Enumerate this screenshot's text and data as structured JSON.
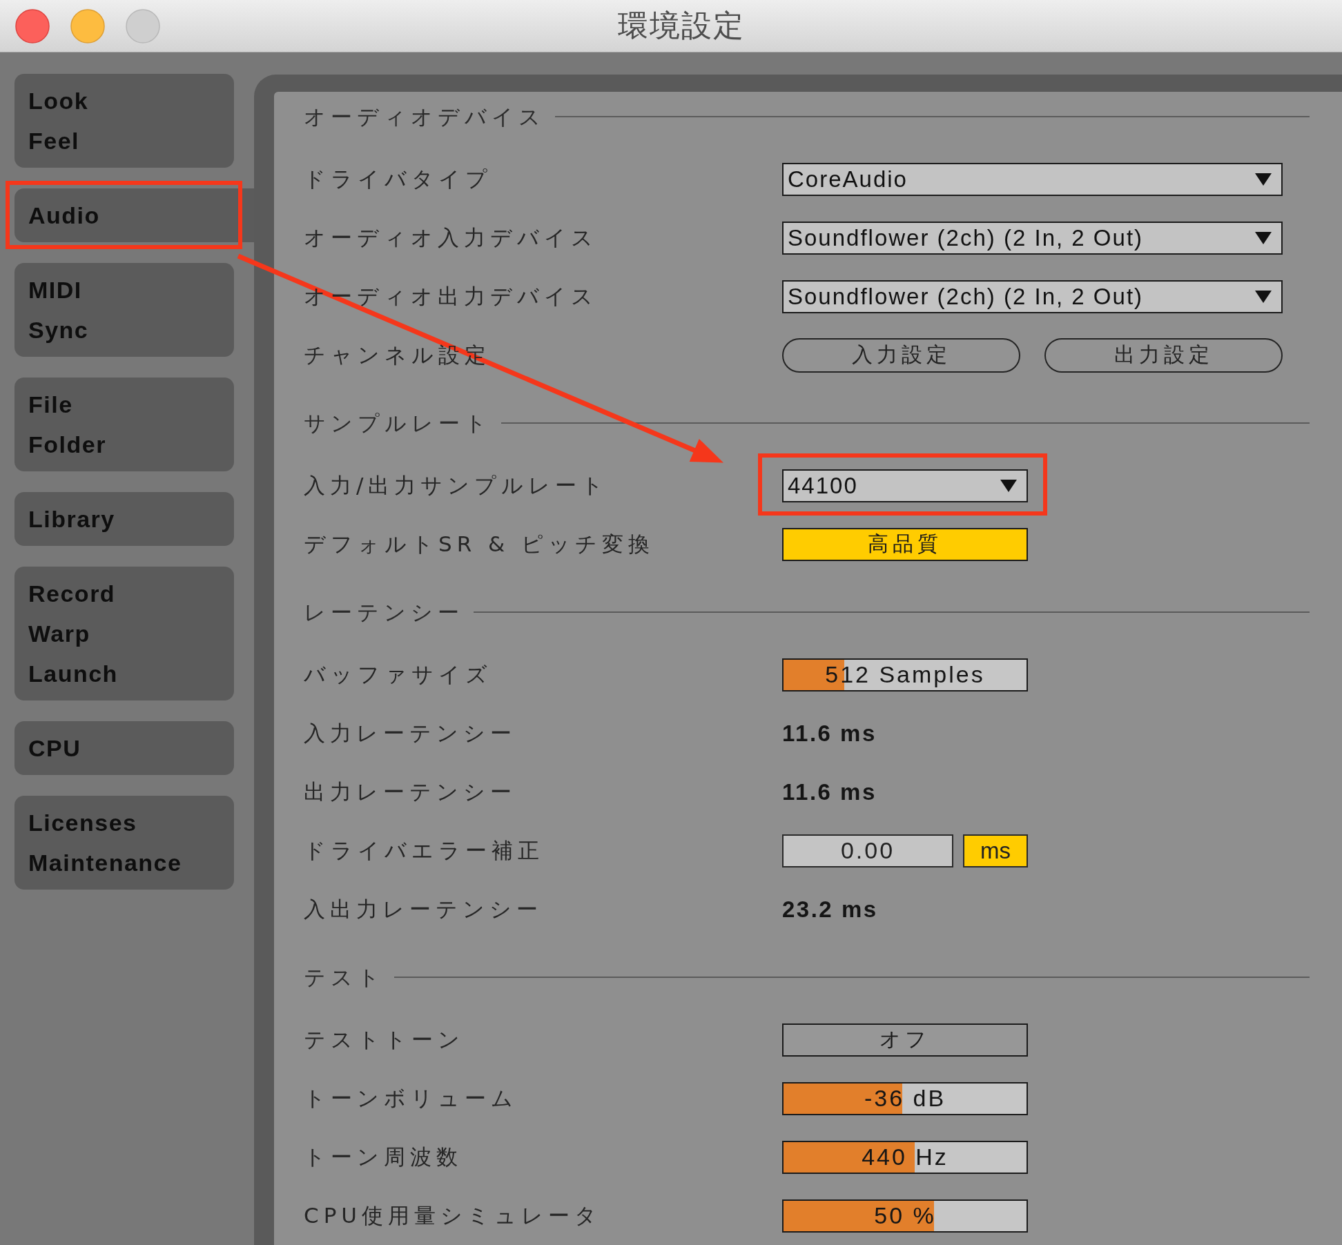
{
  "window": {
    "title": "環境設定",
    "buttons": [
      {
        "kind": "close",
        "disabled": false
      },
      {
        "kind": "minimize",
        "disabled": false
      },
      {
        "kind": "zoom",
        "disabled": true
      }
    ]
  },
  "sidebar": {
    "tabs": [
      {
        "labels": [
          "Look",
          "Feel"
        ],
        "selected": false,
        "highlighted": false
      },
      {
        "labels": [
          "Audio"
        ],
        "selected": true,
        "highlighted": true
      },
      {
        "labels": [
          "MIDI",
          "Sync"
        ],
        "selected": false,
        "highlighted": false
      },
      {
        "labels": [
          "File",
          "Folder"
        ],
        "selected": false,
        "highlighted": false
      },
      {
        "labels": [
          "Library"
        ],
        "selected": false,
        "highlighted": false
      },
      {
        "labels": [
          "Record",
          "Warp",
          "Launch"
        ],
        "selected": false,
        "highlighted": false
      },
      {
        "labels": [
          "CPU"
        ],
        "selected": false,
        "highlighted": false
      },
      {
        "labels": [
          "Licenses",
          "Maintenance"
        ],
        "selected": false,
        "highlighted": false
      }
    ]
  },
  "sections": [
    {
      "title": "オーディオデバイス",
      "rows": [
        {
          "label": "ドライバタイプ",
          "kind": "dropdown",
          "value": "CoreAudio",
          "highlighted": false
        },
        {
          "label": "オーディオ入力デバイス",
          "kind": "dropdown",
          "value": "Soundflower (2ch) (2 In, 2 Out)",
          "highlighted": false
        },
        {
          "label": "オーディオ出力デバイス",
          "kind": "dropdown",
          "value": "Soundflower (2ch) (2 In, 2 Out)",
          "highlighted": false
        },
        {
          "label": "チャンネル設定",
          "kind": "buttons",
          "buttons": [
            "入力設定",
            "出力設定"
          ],
          "highlighted": false
        }
      ]
    },
    {
      "title": "サンプルレート",
      "rows": [
        {
          "label": "入力/出力サンプルレート",
          "kind": "compact",
          "value": "44100",
          "highlighted": true
        },
        {
          "label": "デフォルトSR & ピッチ変換",
          "kind": "toggle",
          "value": "高品質",
          "on": true,
          "highlighted": false
        }
      ]
    },
    {
      "title": "レーテンシー",
      "rows": [
        {
          "label": "バッファサイズ",
          "kind": "slider",
          "value": "512 Samples",
          "level": 0.25,
          "highlighted": false
        },
        {
          "label": "入力レーテンシー",
          "kind": "readout",
          "value": "11.6 ms",
          "highlighted": false
        },
        {
          "label": "出力レーテンシー",
          "kind": "readout",
          "value": "11.6 ms",
          "highlighted": false
        },
        {
          "label": "ドライバエラー補正",
          "kind": "number",
          "value": "0.00",
          "unit": "ms",
          "unit_active": true,
          "highlighted": false
        },
        {
          "label": "入出力レーテンシー",
          "kind": "readout",
          "value": "23.2 ms",
          "highlighted": false
        }
      ]
    },
    {
      "title": "テスト",
      "rows": [
        {
          "label": "テストトーン",
          "kind": "toggle",
          "value": "オフ",
          "on": false,
          "highlighted": false
        },
        {
          "label": "トーンボリューム",
          "kind": "slider",
          "value": "-36 dB",
          "level": 0.49,
          "highlighted": false
        },
        {
          "label": "トーン周波数",
          "kind": "slider",
          "value": "440 Hz",
          "level": 0.54,
          "highlighted": false
        },
        {
          "label": "CPU使用量シミュレータ",
          "kind": "slider",
          "value": "50 %",
          "level": 0.62,
          "highlighted": false
        }
      ]
    }
  ],
  "callout_arrow": true
}
